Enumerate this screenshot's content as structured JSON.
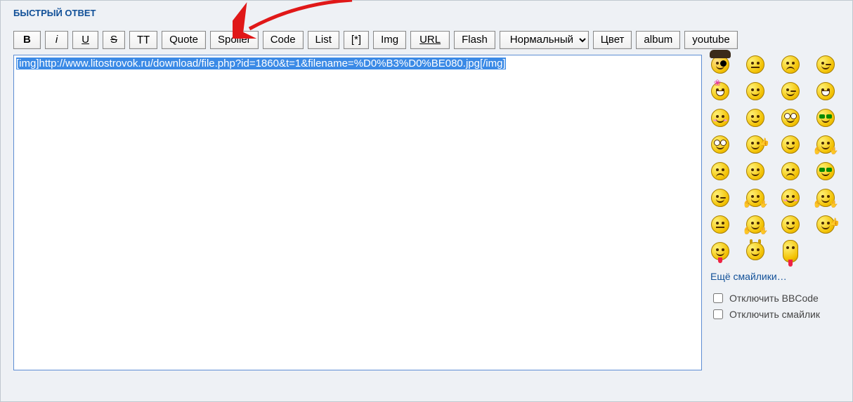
{
  "title": "БЫСТРЫЙ ОТВЕТ",
  "toolbar": {
    "bold": "B",
    "italic": "i",
    "underline": "U",
    "strike": "S",
    "tt": "TT",
    "quote": "Quote",
    "spoiler": "Spoiler",
    "code": "Code",
    "list": "List",
    "list_item": "[*]",
    "img": "Img",
    "url": "URL",
    "flash": "Flash",
    "font_size_selected": "Нормальный",
    "color": "Цвет",
    "album": "album",
    "youtube": "youtube"
  },
  "editor": {
    "content": "[img]http://www.litostrovok.ru/download/file.php?id=1860&t=1&filename=%D0%B3%D0%BE080.jpg[/img]"
  },
  "smilies": {
    "more_link": "Ещё смайлики…",
    "items": [
      "pirate",
      "neutral",
      "sad",
      "wink",
      "bow-grin",
      "smile",
      "wink",
      "grin",
      "shy",
      "drop",
      "roll",
      "cool",
      "roll",
      "thumb",
      "smile",
      "hands",
      "sad-2",
      "smile",
      "sad",
      "cool",
      "wink",
      "hands",
      "shy",
      "hands",
      "neutral",
      "hands",
      "smile",
      "thumb",
      "tongue",
      "dev",
      "long-tongue",
      ""
    ]
  },
  "options": {
    "disable_bbcode": "Отключить BBCode",
    "disable_smilies": "Отключить смайлик"
  },
  "annotation": {
    "arrow_target": "spoiler-button"
  }
}
